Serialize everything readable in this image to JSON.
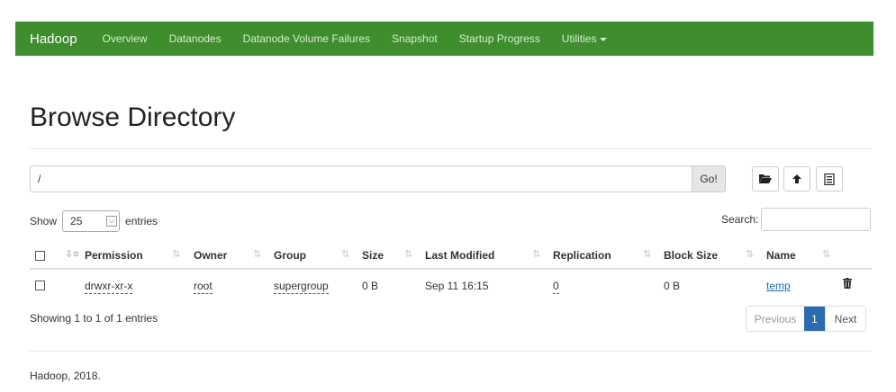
{
  "navbar": {
    "brand": "Hadoop",
    "items": [
      "Overview",
      "Datanodes",
      "Datanode Volume Failures",
      "Snapshot",
      "Startup Progress",
      "Utilities"
    ]
  },
  "page_title": "Browse Directory",
  "path_bar": {
    "value": "/",
    "go_label": "Go!"
  },
  "toolbar": {
    "icons": [
      "folder-icon",
      "upload-icon",
      "list-icon"
    ]
  },
  "table_length": {
    "show_label": "Show",
    "value": "25",
    "entries_label": "entries"
  },
  "search": {
    "label": "Search:"
  },
  "table": {
    "headers": [
      "Permission",
      "Owner",
      "Group",
      "Size",
      "Last Modified",
      "Replication",
      "Block Size",
      "Name"
    ],
    "rows": [
      {
        "permission": "drwxr-xr-x",
        "owner": "root",
        "group": "supergroup",
        "size": "0 B",
        "last_modified": "Sep 11 16:15",
        "replication": "0",
        "block_size": "0 B",
        "name": "temp"
      }
    ]
  },
  "info_text": "Showing 1 to 1 of 1 entries",
  "pagination": {
    "previous": "Previous",
    "current": "1",
    "next": "Next"
  },
  "footer": "Hadoop, 2018.",
  "colors": {
    "navbar": "#3f8e2e",
    "link": "#1a6fb5",
    "active_page": "#2a6cb0"
  }
}
